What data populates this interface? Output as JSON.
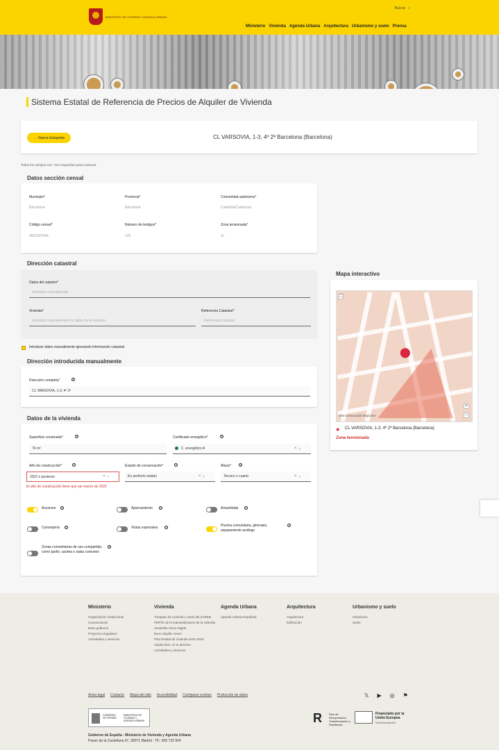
{
  "header": {
    "logo_text": "Ministerio de Vivienda y Agenda Urbana",
    "search": "Buscar",
    "nav": [
      "Ministerio",
      "Vivienda",
      "Agenda Urbana",
      "Arquitectura",
      "Urbanismo y suelo",
      "Prensa"
    ]
  },
  "page": {
    "title": "Sistema Estatal de Referencia de Precios de Alquiler de Vivienda",
    "new_search": "Nueva búsqueda",
    "address": "CL VARSOVIA, 1-3, 4º 2ª Barcelona (Barcelona)",
    "required_note": "Todos los campos con * son requeridos para continuar"
  },
  "census": {
    "title": "Datos sección censal",
    "municipio_label": "Municipio*",
    "municipio_value": "Barcelona",
    "provincia_label": "Provincia*",
    "provincia_value": "Barcelona",
    "comunidad_label": "Comunidad autónoma*",
    "comunidad_value": "Cataluña/Catalunya",
    "codigo_label": "Código censal*",
    "codigo_value": "0801907046",
    "testigos_label": "Número de testigos*",
    "testigos_value": "125",
    "zona_label": "Zona tensionada*",
    "zona_value": "Sí"
  },
  "catastral": {
    "title": "Dirección catastral",
    "datos_label": "Datos del catastro*",
    "datos_value": "Introducir manualmente",
    "vivienda_label": "Vivienda*",
    "vivienda_value": "Introducir manualmente los datos de la vivienda",
    "referencia_label": "Referencia Catastral*",
    "referencia_value": "Referencia catastral",
    "manual_checkbox": "Introducir datos manualmente ignorando información catastral"
  },
  "manual": {
    "title": "Dirección introducida manualmente",
    "address_label": "Dirección completa*",
    "address_value": "CL VARSOVIA, 1-3, 4º 2ª"
  },
  "housing": {
    "title": "Datos de la vivienda",
    "surface_label": "Superficie construida*",
    "surface_value": "76  m²",
    "energy_label": "Certificado energético*",
    "energy_value": "C. energético A",
    "year_label": "Año de construcción*",
    "year_value": "2022 o posterior",
    "state_label": "Estado de conservación*",
    "state_value": "En perfecto estado",
    "height_label": "Altura*",
    "height_value": "Tercero o cuarto",
    "error": "El año de construcción tiene que ser menor de 2022",
    "options": {
      "ascensor": "Ascensor",
      "aparcamiento": "Aparcamiento",
      "amueblada": "Amueblada",
      "conserjeria": "Conserjería",
      "vistas": "Vistas especiales",
      "piscina": "Piscina comunitaria, gimnasio, equipamiento análogo",
      "zonas": "Zonas comunitarias de uso compartido, como jardín, azotea o salas comunes"
    }
  },
  "map": {
    "title": "Mapa interactivo",
    "address": "CL VARSOVIA, 1-3, 4º 2ª Barcelona (Barcelona)",
    "zone": "Zona tensionada",
    "attribution": "IGN  Cartociudad  MapLibre"
  },
  "footer": {
    "columns": [
      {
        "title": "Ministerio",
        "items": [
          "Organización institucional",
          "Comunicación",
          "Buen gobierno",
          "Proyectos singulares",
          "Actividades y servicios"
        ]
      },
      {
        "title": "Vivienda",
        "items": [
          "Traspaso de vivienda y suelo del SAREB",
          "PERTE de la industrialización de la vivienda",
          "Ventanilla Única Digital",
          "Bono Alquiler Joven",
          "Plan Estatal de Vivienda 2022-2025",
          "Alquila bien, es tu derecho",
          "Actividades y servicios"
        ]
      },
      {
        "title": "Agenda Urbana",
        "items": [
          "Agenda Urbana Española"
        ]
      },
      {
        "title": "Arquitectura",
        "items": [
          "Arquitectura",
          "Edificación"
        ]
      },
      {
        "title": "Urbanismo y suelo",
        "items": [
          "Urbanismo",
          "Suelo"
        ]
      }
    ],
    "links": [
      "Aviso legal",
      "Contacto",
      "Mapa del sitio",
      "Accesibilidad",
      "Configurar cookies",
      "Protección de datos"
    ],
    "bottom_title": "Gobierno de España - Ministerio de Vivienda y Agenda Urbana",
    "bottom_address": "Paseo de la Castellana 67, 28071 Madrid - Tlf.: 900 732 904",
    "gov_text_left": "GOBIERNO DE ESPAÑA",
    "gov_text_right": "MINISTERIO DE VIVIENDA Y AGENDA URBANA",
    "plan_text": "Plan de Recuperación, Transformación y Resiliencia",
    "eu_text": "Financiado por la Unión Europea",
    "eu_sub": "NextGenerationEU"
  }
}
